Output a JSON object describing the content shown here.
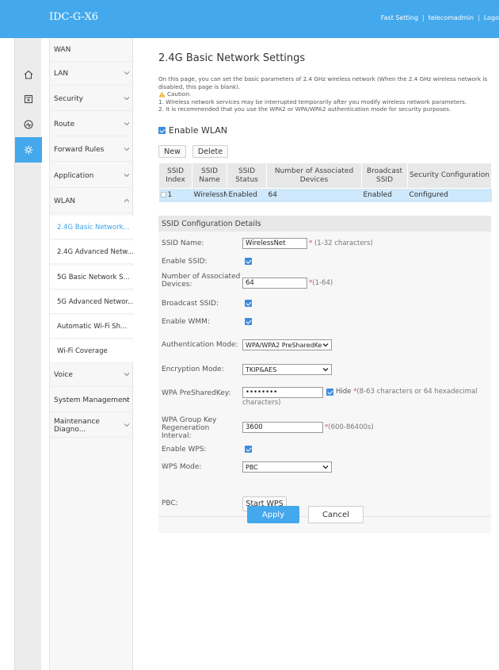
{
  "app": {
    "title": "IDC-G-X6"
  },
  "topbar": {
    "fast_setting": "Fast Setting",
    "separator": "|",
    "user": "telecomadmin",
    "logout": "Logo"
  },
  "nav": {
    "items": [
      {
        "label": "WAN"
      },
      {
        "label": "LAN"
      },
      {
        "label": "Security"
      },
      {
        "label": "Route"
      },
      {
        "label": "Forward Rules"
      },
      {
        "label": "Application"
      },
      {
        "label": "WLAN"
      },
      {
        "label": "Voice"
      },
      {
        "label": "System Management"
      },
      {
        "label": "Maintenance Diagno..."
      }
    ],
    "wlan_sub": [
      {
        "label": "2.4G Basic Network..."
      },
      {
        "label": "2.4G Advanced Netw..."
      },
      {
        "label": "5G Basic Network S..."
      },
      {
        "label": "5G Advanced Networ..."
      },
      {
        "label": "Automatic Wi-Fi Sh..."
      },
      {
        "label": "Wi-Fi Coverage"
      }
    ]
  },
  "page": {
    "title": "2.4G Basic Network Settings",
    "intro": "On this page, you can set the basic parameters of 2.4 GHz wireless network (When the 2.4 GHz wireless network is disabled, this page is blank).",
    "caution_label": "Caution:",
    "caution_1": "1. Wireless network services may be interrupted temporarily after you modify wireless network parameters.",
    "caution_2": "2. It is recommended that you use the WPA2 or WPA/WPA2 authentication mode for security purposes.",
    "enable_wlan": "Enable WLAN",
    "new_button": "New",
    "delete_button": "Delete"
  },
  "table": {
    "headers": [
      "SSID Index",
      "SSID Name",
      "SSID Status",
      "Number of Associated Devices",
      "Broadcast SSID",
      "Security Configuration"
    ],
    "rows": [
      {
        "index": "1",
        "name": "WirelessNet",
        "status": "Enabled",
        "devices": "64",
        "broadcast": "Enabled",
        "security": "Configured"
      }
    ]
  },
  "details": {
    "heading": "SSID Configuration Details",
    "ssid_name_label": "SSID Name:",
    "ssid_name_value": "WirelessNet",
    "ssid_name_hint": "(1-32 characters)",
    "enable_ssid_label": "Enable SSID:",
    "num_devices_label": "Number of Associated Devices:",
    "num_devices_value": "64",
    "num_devices_hint": "(1-64)",
    "broadcast_label": "Broadcast SSID:",
    "wmm_label": "Enable WMM:",
    "auth_label": "Authentication Mode:",
    "auth_value": "WPA/WPA2 PreSharedKe",
    "enc_label": "Encryption Mode:",
    "enc_value": "TKIP&AES",
    "psk_label": "WPA PreSharedKey:",
    "psk_value": "••••••••",
    "hide_label": "Hide",
    "psk_hint_1": "(8-63 characters or 64 hexadecimal",
    "psk_hint_2": "characters)",
    "regen_label": "WPA Group Key Regeneration Interval:",
    "regen_value": "3600",
    "regen_hint": "(600-86400s)",
    "wps_label": "Enable WPS:",
    "wps_mode_label": "WPS Mode:",
    "wps_mode_value": "PBC",
    "pbc_label": "PBC:",
    "start_wps": "Start WPS",
    "required_mark": "*"
  },
  "actions": {
    "apply": "Apply",
    "cancel": "Cancel"
  },
  "colors": {
    "accent": "#44a9ec",
    "selected_row": "#cfe8fb",
    "checkbox": "#3d8ce0",
    "required": "#e24b4b"
  }
}
